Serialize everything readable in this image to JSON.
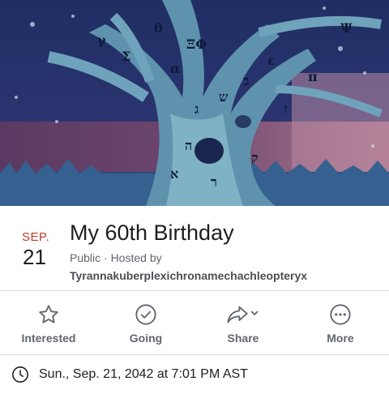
{
  "event": {
    "month": "SEP.",
    "day": "21",
    "title": "My 60th Birthday",
    "privacy_host": "Public · Hosted by",
    "host": "Tyrannakuberplexichronamechachleopteryx",
    "datetime": "Sun., Sep. 21, 2042 at 7:01 PM AST"
  },
  "actions": [
    {
      "label": "Interested",
      "icon": "star-icon"
    },
    {
      "label": "Going",
      "icon": "check-circle-icon"
    },
    {
      "label": "Share",
      "icon": "share-icon"
    },
    {
      "label": "More",
      "icon": "more-icon"
    }
  ],
  "colors": {
    "month": "#c0392b",
    "cover_sky": "#1b2a55",
    "cover_ground": "#8a5a7a"
  }
}
